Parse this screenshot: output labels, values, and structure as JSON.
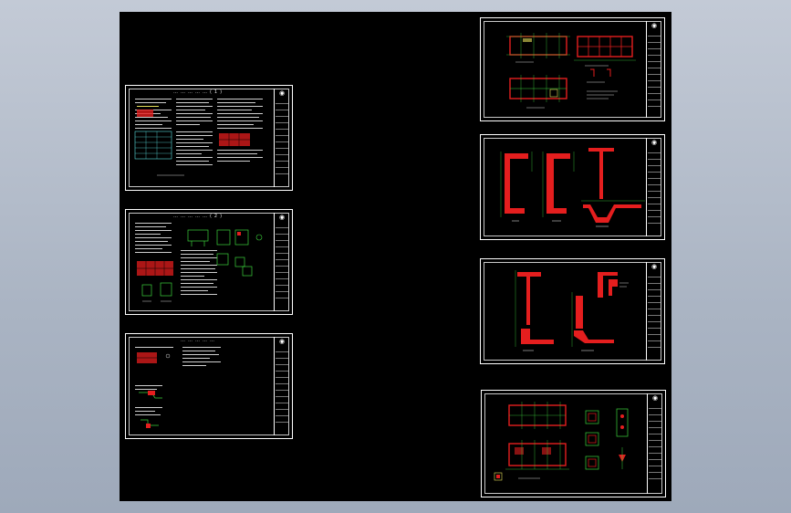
{
  "viewport": {
    "background": "#b7c0cd",
    "canvas_color": "#000000"
  },
  "sheets": [
    {
      "id": "spec-1",
      "title": "……………(1)",
      "kind": "notes"
    },
    {
      "id": "spec-2",
      "title": "……………(2)",
      "kind": "notes"
    },
    {
      "id": "spec-3",
      "title": "……………",
      "kind": "notes"
    },
    {
      "id": "plan",
      "kind": "plan-drawing"
    },
    {
      "id": "section-1",
      "kind": "section-drawing"
    },
    {
      "id": "section-2",
      "kind": "section-drawing"
    },
    {
      "id": "plan-detail",
      "kind": "plan-detail-drawing"
    }
  ],
  "colors": {
    "frame": "#ffffff",
    "wall_fill": "#e41e1e",
    "grid_line": "#3cd23c",
    "dimension": "#3cd23c",
    "text": "#cfcfcf",
    "accent_text": "#e6e05a",
    "cyan_text": "#5ae0e0"
  },
  "icons": {
    "logo": "seal-icon"
  }
}
